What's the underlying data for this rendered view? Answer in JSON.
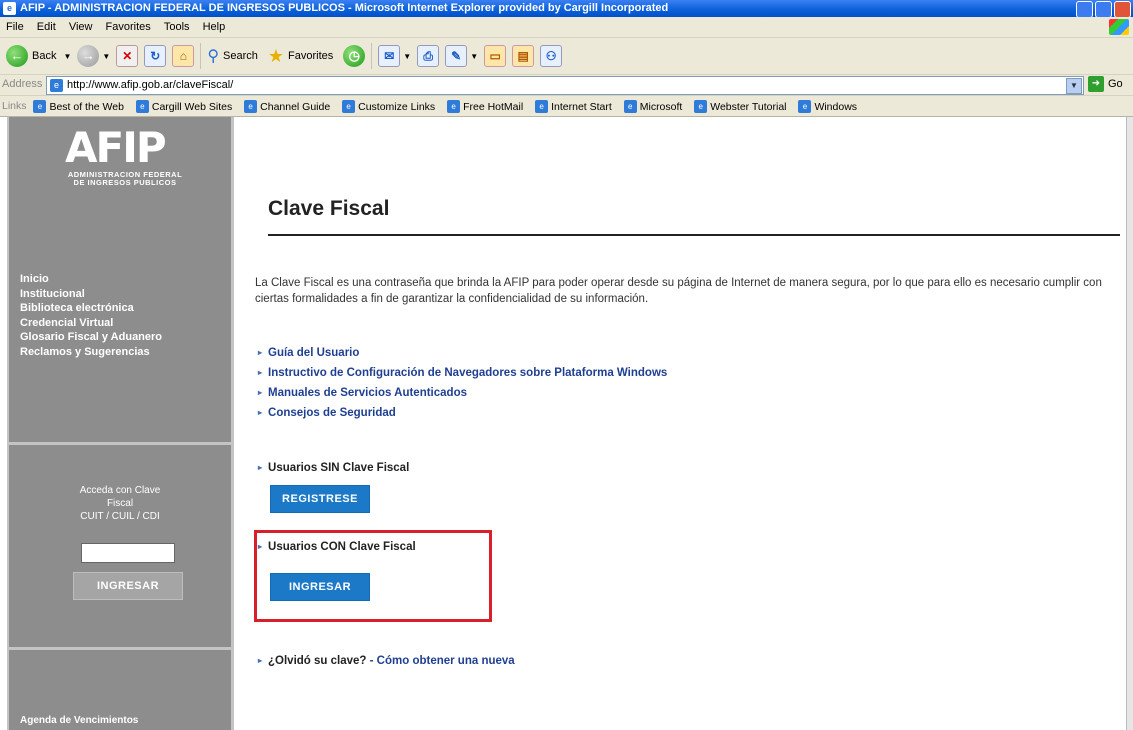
{
  "window": {
    "title": "AFIP - ADMINISTRACION FEDERAL DE INGRESOS PUBLICOS - Microsoft Internet Explorer provided by Cargill Incorporated"
  },
  "menu": [
    "File",
    "Edit",
    "View",
    "Favorites",
    "Tools",
    "Help"
  ],
  "toolbar": {
    "back": "Back",
    "search": "Search",
    "favorites": "Favorites"
  },
  "address": {
    "label": "Address",
    "url": "http://www.afip.gob.ar/claveFiscal/",
    "go": "Go"
  },
  "links": {
    "label": "Links",
    "items": [
      "Best of the Web",
      "Cargill Web Sites",
      "Channel Guide",
      "Customize Links",
      "Free HotMail",
      "Internet Start",
      "Microsoft",
      "Webster Tutorial",
      "Windows"
    ]
  },
  "sidebar": {
    "logo": "AFIP",
    "logo_sub": "ADMINISTRACION FEDERAL DE INGRESOS PUBLICOS",
    "nav": [
      "Inicio",
      "Institucional",
      "Biblioteca electrónica",
      "Credencial Virtual",
      "Glosario Fiscal y Aduanero",
      "Reclamos y Sugerencias"
    ],
    "login_line1": "Acceda con Clave",
    "login_line2": "Fiscal",
    "login_line3": "CUIT / CUIL / CDI",
    "login_button": "INGRESAR",
    "agenda": "Agenda de Vencimientos"
  },
  "main": {
    "title": "Clave Fiscal",
    "intro": "La Clave Fiscal es una contraseña que brinda la AFIP para poder operar desde su página de Internet de manera segura, por lo que para ello es necesario cumplir con ciertas formalidades a fin de garantizar la confidencialidad de su información.",
    "links": [
      "Guía del Usuario",
      "Instructivo de Configuración de Navegadores sobre Plataforma Windows",
      "Manuales de Servicios Autenticados",
      "Consejos de Seguridad"
    ],
    "sin_label": "Usuarios SIN Clave Fiscal",
    "sin_button": "REGISTRESE",
    "con_label": "Usuarios CON Clave Fiscal",
    "con_button": "INGRESAR",
    "forgot_q": "¿Olvidó su clave?",
    "forgot_link": "Cómo obtener una nueva"
  },
  "colors": {
    "title_bar": "#0a5fd8",
    "sidebar": "#8d8d8d",
    "accent_button": "#1b79c8",
    "highlight": "#d8202b",
    "link": "#1f3f91"
  }
}
